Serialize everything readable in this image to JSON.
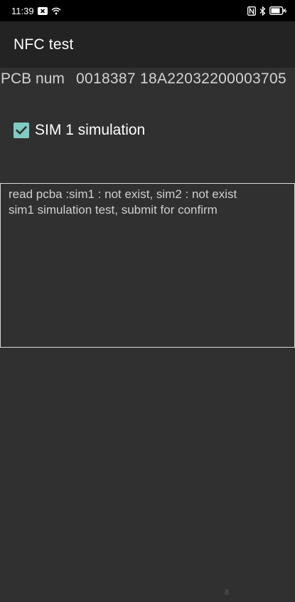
{
  "status_bar": {
    "time": "11:39",
    "icons": [
      "notification-x-icon",
      "wifi-icon",
      "nfc-icon",
      "bluetooth-icon",
      "battery-icon"
    ]
  },
  "app_bar": {
    "title": "NFC test"
  },
  "pcb": {
    "label": "PCB num",
    "value": "0018387 18A22032200003705"
  },
  "sim": {
    "checked": true,
    "label": "SIM 1 simulation"
  },
  "result": {
    "lines": [
      "read pcba :sim1 : not exist, sim2 : not exist",
      "sim1 simulation test, submit for confirm"
    ]
  },
  "page_indicator": "8",
  "colors": {
    "background": "#303030",
    "app_bar": "#232323",
    "status_bar": "#000000",
    "checkbox_accent": "#80cbc4"
  }
}
